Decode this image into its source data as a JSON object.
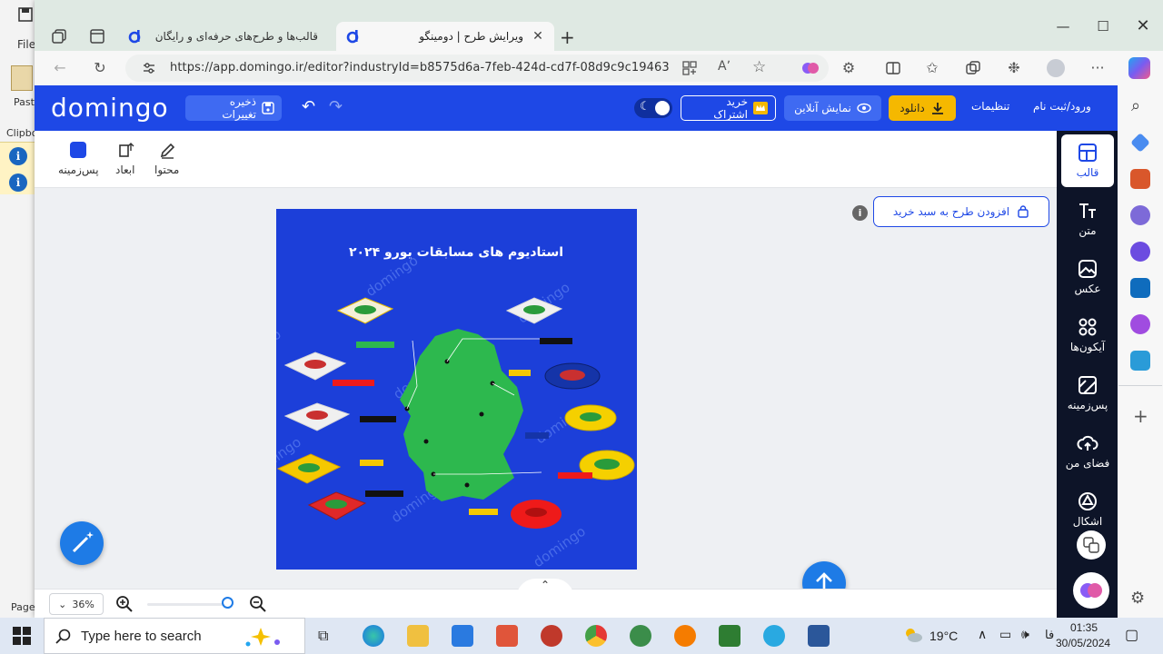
{
  "browser": {
    "tabs": [
      {
        "label": "قالب‌ها و طرح‌های حرفه‌ای و رایگان",
        "active": false
      },
      {
        "label": "ویرایش طرح | دومینگو",
        "active": true
      }
    ],
    "url": "https://app.domingo.ir/editor?industryId=b8575d6a-7feb-424d-cd7f-08d9c9c19463"
  },
  "background_app": {
    "file_label": "File",
    "paste_label": "Past",
    "clipboard_label": "Clipbo",
    "page_label": "Page"
  },
  "domingo": {
    "logo": "domingo",
    "save_label": "ذخیره تغییرات",
    "subscribe_label": "خرید اشتراک",
    "live_label": "نمایش آنلاین",
    "download_label": "دانلود",
    "settings_label": "تنظیمات",
    "login_label": "ورود/ثبت نام",
    "toolbar": {
      "content_label": "محتوا",
      "dimensions_label": "ابعاد",
      "background_label": "پس‌زمینه"
    },
    "right_menu": [
      {
        "label": "قالب",
        "icon": "template-icon",
        "active": true
      },
      {
        "label": "متن",
        "icon": "text-icon"
      },
      {
        "label": "عکس",
        "icon": "image-icon"
      },
      {
        "label": "آیکون‌ها",
        "icon": "icons-icon"
      },
      {
        "label": "پس‌زمینه",
        "icon": "background-icon"
      },
      {
        "label": "فضای من",
        "icon": "cloud-upload-icon"
      },
      {
        "label": "اشکال",
        "icon": "shapes-icon"
      }
    ],
    "add_to_cart_label": "افزودن طرح به سبد خرید",
    "zoom": "36%",
    "design": {
      "title": "استادیوم های مسابقات یورو ۲۰۲۴",
      "watermark": "domingo"
    }
  },
  "taskbar": {
    "search_placeholder": "Type here to search",
    "temperature": "19°C",
    "language": "فا",
    "time": "01:35",
    "date": "30/05/2024"
  },
  "colors": {
    "brand_blue": "#1e48e6",
    "download_yellow": "#f5b800",
    "sidebar_dark": "#0d1428",
    "design_bg": "#1c3fd9",
    "map_green": "#2db84e"
  }
}
